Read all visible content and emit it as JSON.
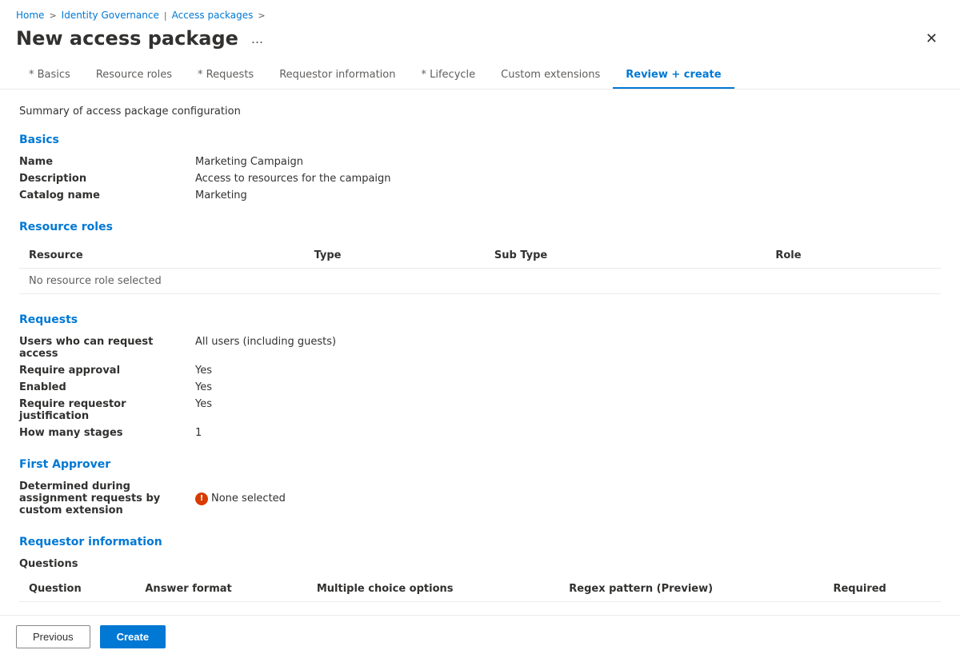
{
  "breadcrumb": {
    "home": "Home",
    "identity_governance": "Identity Governance",
    "separator1": ">",
    "access_packages": "Access packages",
    "separator2": ">"
  },
  "page": {
    "title": "New access package",
    "ellipsis": "...",
    "close": "✕",
    "summary_text": "Summary of access package configuration"
  },
  "tabs": [
    {
      "label": "* Basics",
      "id": "basics",
      "active": false
    },
    {
      "label": "Resource roles",
      "id": "resource-roles",
      "active": false
    },
    {
      "label": "* Requests",
      "id": "requests",
      "active": false
    },
    {
      "label": "Requestor information",
      "id": "requestor-information",
      "active": false
    },
    {
      "label": "* Lifecycle",
      "id": "lifecycle",
      "active": false
    },
    {
      "label": "Custom extensions",
      "id": "custom-extensions",
      "active": false
    },
    {
      "label": "Review + create",
      "id": "review-create",
      "active": true
    }
  ],
  "basics_section": {
    "title": "Basics",
    "fields": [
      {
        "label": "Name",
        "value": "Marketing Campaign"
      },
      {
        "label": "Description",
        "value": "Access to resources for the campaign"
      },
      {
        "label": "Catalog name",
        "value": "Marketing"
      }
    ]
  },
  "resource_roles_section": {
    "title": "Resource roles",
    "columns": [
      "Resource",
      "Type",
      "Sub Type",
      "Role"
    ],
    "no_data": "No resource role selected"
  },
  "requests_section": {
    "title": "Requests",
    "fields": [
      {
        "label": "Users who can request access",
        "value": "All users (including guests)"
      },
      {
        "label": "Require approval",
        "value": "Yes"
      },
      {
        "label": "Enabled",
        "value": "Yes"
      },
      {
        "label": "Require requestor justification",
        "value": "Yes"
      },
      {
        "label": "How many stages",
        "value": "1"
      }
    ]
  },
  "first_approver_section": {
    "title": "First Approver",
    "label": "Determined during assignment requests by custom extension",
    "warning_icon": "!",
    "value": "None selected"
  },
  "requestor_information_section": {
    "title": "Requestor information",
    "questions_label": "Questions",
    "columns": [
      "Question",
      "Answer format",
      "Multiple choice options",
      "Regex pattern (Preview)",
      "Required"
    ]
  },
  "footer": {
    "previous_label": "Previous",
    "create_label": "Create"
  }
}
